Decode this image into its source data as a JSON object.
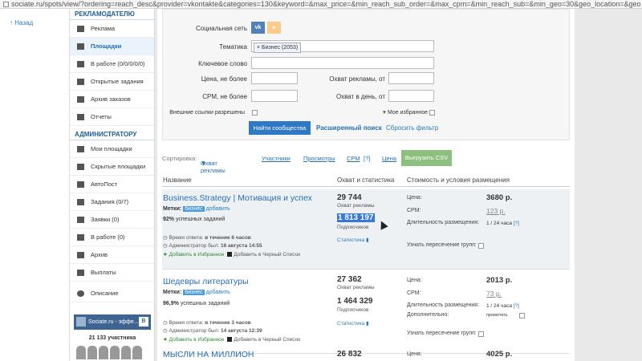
{
  "address": "sociate.ru/spots/view/?ordering=reach_desc&provider=vkontakte&categories=130&keyword=&max_price=&min_reach_sub_order=&max_cpm=&min_reach_sub=&min_geo=30&geo_location=&geo",
  "back_label": "Назад",
  "sidebar": {
    "advertiser_header": "РЕКЛАМОДАТЕЛЮ",
    "advertiser_items": [
      {
        "label": "Реклама",
        "icon": "bookmark-icon"
      },
      {
        "label": "Площадки",
        "icon": "list-icon",
        "active": true
      },
      {
        "label": "В работе (0/0/0/0/0)",
        "icon": "play-icon"
      },
      {
        "label": "Открытые задания",
        "icon": "play-icon"
      },
      {
        "label": "Архив заказов",
        "icon": "car-icon"
      },
      {
        "label": "Отчеты",
        "icon": "report-icon"
      }
    ],
    "admin_header": "АДМИНИСТРАТОРУ",
    "admin_items": [
      {
        "label": "Мои площадки",
        "icon": "list-icon"
      },
      {
        "label": "Скрытые площадки",
        "icon": "list-icon"
      },
      {
        "label": "АвтоПост",
        "icon": "refresh-icon"
      },
      {
        "label": "Задания (0/7)",
        "icon": "play-icon"
      },
      {
        "label": "Заявки (0)",
        "icon": "file-icon"
      },
      {
        "label": "В работе (0)",
        "icon": "play-icon"
      },
      {
        "label": "Архив",
        "icon": "car-icon"
      },
      {
        "label": "Выплаты",
        "icon": "payout-icon"
      }
    ],
    "about_label": "Описание",
    "vk_widget": "Sociate.ru - эффе...",
    "members": "21 133 участника"
  },
  "filter": {
    "network_label": "Социальная сеть",
    "vk_btn": "vk",
    "ok_btn": "ok",
    "topic_label": "Тематика",
    "topic_tag": "Бизнес (2053)",
    "keyword_label": "Ключевое слово",
    "price_label": "Цена, не более",
    "reach_label": "Охват рекламы, от",
    "cpm_label": "CPM, не более",
    "reach_day_label": "Охват в день, от",
    "external_label": "Внешние ссылки разрешены",
    "favorites_label": "Мое избранное",
    "find_btn": "Найти сообщества",
    "extended": "Расширенный поиск",
    "reset": "Сбросить фильтр"
  },
  "sort": {
    "label": "Сортировка:",
    "reach": "Охват рекламы",
    "members": "Участники",
    "views": "Просмотры",
    "cpm": "CPM",
    "cpm_q": "[?]",
    "price": "Цена",
    "csv": "Выгрузить CSV"
  },
  "table": {
    "h_name": "Название",
    "h_reach": "Охват и статистика",
    "h_cost": "Стоимость и условия размещения"
  },
  "rows": [
    {
      "name": "Business.Strategy | Мотивация и успех",
      "tags_label": "Метки:",
      "tag": "бизнес",
      "add": "добавить",
      "success": "92%",
      "success_text": "успешных заданий",
      "response_label": "Время ответа:",
      "response_value": "в течение 6 часов",
      "admin_label": "Администратор был:",
      "admin_value": "16 августа 14:55",
      "fav": "Добавить в Избранное",
      "black": "Добавить в Черный Список",
      "reach": "29 744",
      "reach_sub": "Охват рекламы",
      "subs": "1 813 197",
      "subs_sub": "Подписчиков",
      "stats": "Статистика",
      "price_label": "Цена:",
      "price": "3680 р.",
      "cpm_label": "CPM:",
      "cpm": "123 р.",
      "dur_label": "Длительность размещения:",
      "dur": "1 / 24 часа",
      "dur_q": "[?]",
      "cross_label": "Узнать пересечение групп:"
    },
    {
      "name": "Шедевры литературы",
      "tags_label": "Метки:",
      "tag": "бизнес",
      "add": "добавить",
      "success": "96,9%",
      "success_text": "успешных заданий",
      "response_label": "Время ответа:",
      "response_value": "в течение 3 часов",
      "admin_label": "Администратор был:",
      "admin_value": "14 августа 12:39",
      "fav": "Добавить в Избранное",
      "black": "Добавить в Черный Список",
      "reach": "27 362",
      "reach_sub": "Охват рекламы",
      "subs": "1 464 329",
      "subs_sub": "Подписчиков",
      "stats": "Статистика",
      "price_label": "Цена:",
      "price": "2013 р.",
      "cpm_label": "CPM:",
      "cpm": "73 р.",
      "dur_label": "Длительность размещения:",
      "dur": "1 / 24 часа",
      "dur_q": "[?]",
      "extra_label": "Дополнительно:",
      "extra": "промотать",
      "cross_label": "Узнать пересечение групп:"
    },
    {
      "name": "МЫСЛИ НА МИЛЛИОН",
      "reach": "26 832",
      "price_label": "Цена:",
      "price": "4025 р."
    }
  ]
}
